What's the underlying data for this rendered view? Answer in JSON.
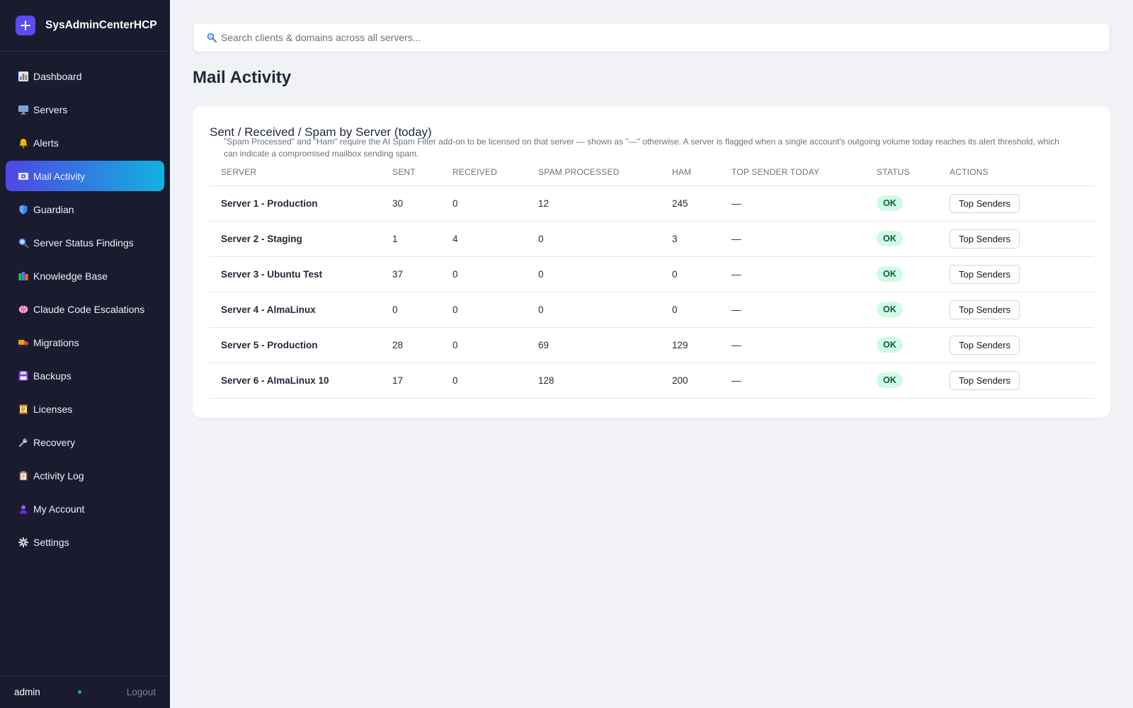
{
  "app": {
    "name": "SysAdminCenterHCP",
    "logo_icon": "plus-icon",
    "accent": "#5b4bf0"
  },
  "sidebar": {
    "items": [
      {
        "label": "Dashboard",
        "icon": "bar-chart-icon",
        "active": false
      },
      {
        "label": "Servers",
        "icon": "monitor-icon",
        "active": false
      },
      {
        "label": "Alerts",
        "icon": "bell-icon",
        "active": false
      },
      {
        "label": "Mail Activity",
        "icon": "mail-icon",
        "active": true
      },
      {
        "label": "Guardian",
        "icon": "shield-icon",
        "active": false
      },
      {
        "label": "Server Status Findings",
        "icon": "magnifier-icon",
        "active": false
      },
      {
        "label": "Knowledge Base",
        "icon": "books-icon",
        "active": false
      },
      {
        "label": "Claude Code Escalations",
        "icon": "brain-icon",
        "active": false
      },
      {
        "label": "Migrations",
        "icon": "truck-icon",
        "active": false
      },
      {
        "label": "Backups",
        "icon": "floppy-disk-icon",
        "active": false
      },
      {
        "label": "Licenses",
        "icon": "scroll-icon",
        "active": false
      },
      {
        "label": "Recovery",
        "icon": "wrench-icon",
        "active": false
      },
      {
        "label": "Activity Log",
        "icon": "clipboard-icon",
        "active": false
      },
      {
        "label": "My Account",
        "icon": "user-icon",
        "active": false
      },
      {
        "label": "Settings",
        "icon": "gear-icon",
        "active": false
      }
    ],
    "footer": {
      "user": "admin",
      "logout_label": "Logout"
    }
  },
  "search": {
    "placeholder": "Search clients & domains across all servers..."
  },
  "page": {
    "title": "Mail Activity"
  },
  "card": {
    "title": "Sent / Received / Spam by Server (today)",
    "note": "\"Spam Processed\" and \"Ham\" require the AI Spam Filter add-on to be licensed on that server — shown as \"—\" otherwise. A server is flagged when a single account's outgoing volume today reaches its alert threshold, which can indicate a compromised mailbox sending spam."
  },
  "table": {
    "headers": [
      "Server",
      "Sent",
      "Received",
      "Spam Processed",
      "Ham",
      "Top Sender Today",
      "Status",
      "Actions"
    ],
    "rows": [
      {
        "server": "Server 1 - Production",
        "sent": "30",
        "received": "0",
        "spam": "12",
        "ham": "245",
        "top_sender": "—",
        "status": "OK",
        "action": "Top Senders"
      },
      {
        "server": "Server 2 - Staging",
        "sent": "1",
        "received": "4",
        "spam": "0",
        "ham": "3",
        "top_sender": "—",
        "status": "OK",
        "action": "Top Senders"
      },
      {
        "server": "Server 3 - Ubuntu Test",
        "sent": "37",
        "received": "0",
        "spam": "0",
        "ham": "0",
        "top_sender": "—",
        "status": "OK",
        "action": "Top Senders"
      },
      {
        "server": "Server 4 - AlmaLinux",
        "sent": "0",
        "received": "0",
        "spam": "0",
        "ham": "0",
        "top_sender": "—",
        "status": "OK",
        "action": "Top Senders"
      },
      {
        "server": "Server 5 - Production",
        "sent": "28",
        "received": "0",
        "spam": "69",
        "ham": "129",
        "top_sender": "—",
        "status": "OK",
        "action": "Top Senders"
      },
      {
        "server": "Server 6 - AlmaLinux 10",
        "sent": "17",
        "received": "0",
        "spam": "128",
        "ham": "200",
        "top_sender": "—",
        "status": "OK",
        "action": "Top Senders"
      }
    ]
  }
}
